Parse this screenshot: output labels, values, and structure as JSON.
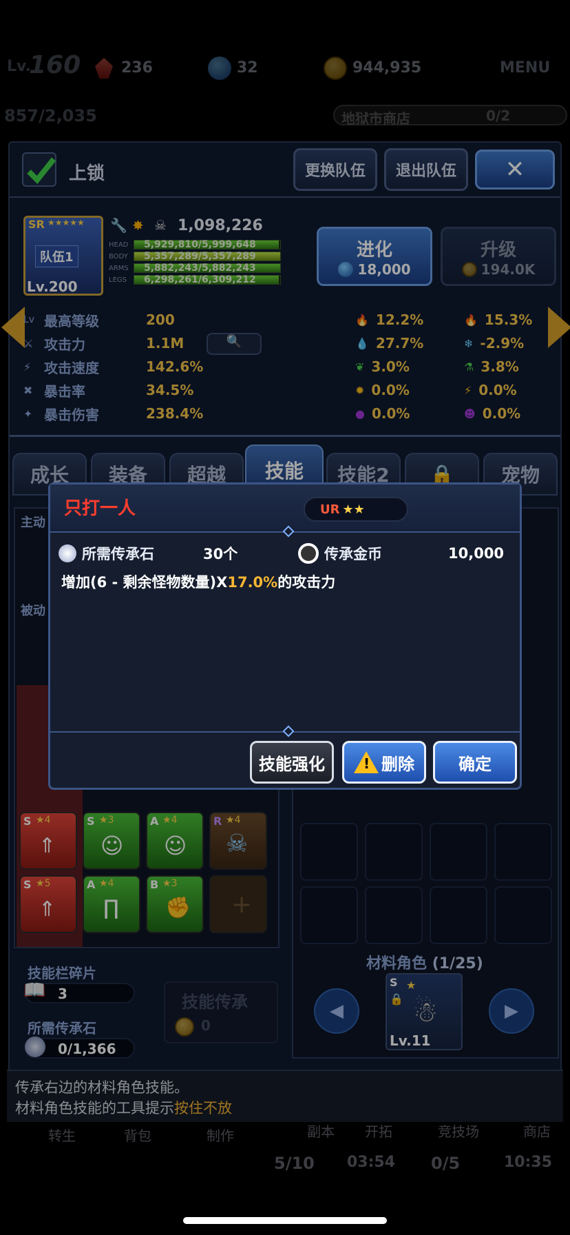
{
  "top": {
    "lv_label": "Lv.",
    "lv_value": "160",
    "red_gems": "236",
    "blue_gems": "32",
    "gold": "944,935",
    "menu": "MENU",
    "exp": "857/2,035",
    "shop": "地狱市商店",
    "shop_count": "0/2"
  },
  "panel": {
    "lock_label": "上锁",
    "change_team": "更换队伍",
    "leave_team": "退出队伍",
    "hero": {
      "rarity": "SR",
      "team": "队伍1",
      "level": "Lv.200",
      "power": "1,098,226",
      "bars": [
        {
          "label": "HEAD",
          "text": "5,929,810/5,999,648",
          "fill": 0.99
        },
        {
          "label": "BODY",
          "text": "5,357,289/5,357,289",
          "fill": 1.0
        },
        {
          "label": "ARMS",
          "text": "5,882,243/5,882,243",
          "fill": 1.0
        },
        {
          "label": "LEGS",
          "text": "6,298,261/6,309,212",
          "fill": 0.99
        }
      ]
    },
    "evolve": {
      "label": "进化",
      "cost": "18,000"
    },
    "upgrade": {
      "label": "升级",
      "cost": "194.0K"
    },
    "stats": [
      {
        "label": "最高等级",
        "value": "200"
      },
      {
        "label": "攻击力",
        "value": "1.1M"
      },
      {
        "label": "攻击速度",
        "value": "142.6%"
      },
      {
        "label": "暴击率",
        "value": "34.5%"
      },
      {
        "label": "暴击伤害",
        "value": "238.4%"
      }
    ],
    "elements_left": [
      "12.2%",
      "27.7%",
      "3.0%",
      "0.0%",
      "0.0%"
    ],
    "elements_right": [
      "15.3%",
      "-2.9%",
      "3.8%",
      "0.0%",
      "0.0%"
    ],
    "tabs": [
      "成长",
      "装备",
      "超越",
      "技能",
      "技能2",
      "",
      "宠物"
    ],
    "side_labels": {
      "active": "主动",
      "passive": "被动"
    },
    "fragments_label": "技能栏碎片",
    "fragments_value": "3",
    "inherit_stone_label": "所需传承石",
    "inherit_stone_value": "0/1,366",
    "inherit_button": "技能传承",
    "inherit_cost": "0",
    "material_label": "材料角色",
    "material_count": "(1/25)",
    "material_level": "Lv.11",
    "material_rank": "S",
    "skill_cards": [
      {
        "rank": "S",
        "stars": "4"
      },
      {
        "rank": "S",
        "stars": "3"
      },
      {
        "rank": "A",
        "stars": "4"
      },
      {
        "rank": "R",
        "stars": "4"
      },
      {
        "rank": "S",
        "stars": "5"
      },
      {
        "rank": "A",
        "stars": "4"
      },
      {
        "rank": "B",
        "stars": "3"
      }
    ]
  },
  "modal": {
    "title": "只打一人",
    "grade": "UR",
    "stone_label": "所需传承石",
    "stone_value": "30个",
    "coin_label": "传承金币",
    "coin_value": "10,000",
    "desc_prefix": "增加(6 - 剩余怪物数量)X",
    "desc_highlight": "17.0%",
    "desc_suffix": "的攻击力",
    "btn_enhance": "技能强化",
    "btn_delete": "删除",
    "btn_confirm": "确定"
  },
  "footer": {
    "line1": "传承右边的材料角色技能。",
    "line2_prefix": "材料角色技能的工具提示",
    "line2_highlight": "按住不放"
  },
  "bottom_nav": {
    "items": [
      "转生",
      "背包",
      "制作",
      "副本",
      "开拓",
      "竞技场",
      "商店"
    ],
    "timers": [
      "5/10",
      "03:54",
      "0/5",
      "10:35"
    ]
  },
  "colors": {
    "title_red": "#ff3d2e",
    "highlight_gold": "#f6b633",
    "accent_blue": "#3f79c9"
  }
}
